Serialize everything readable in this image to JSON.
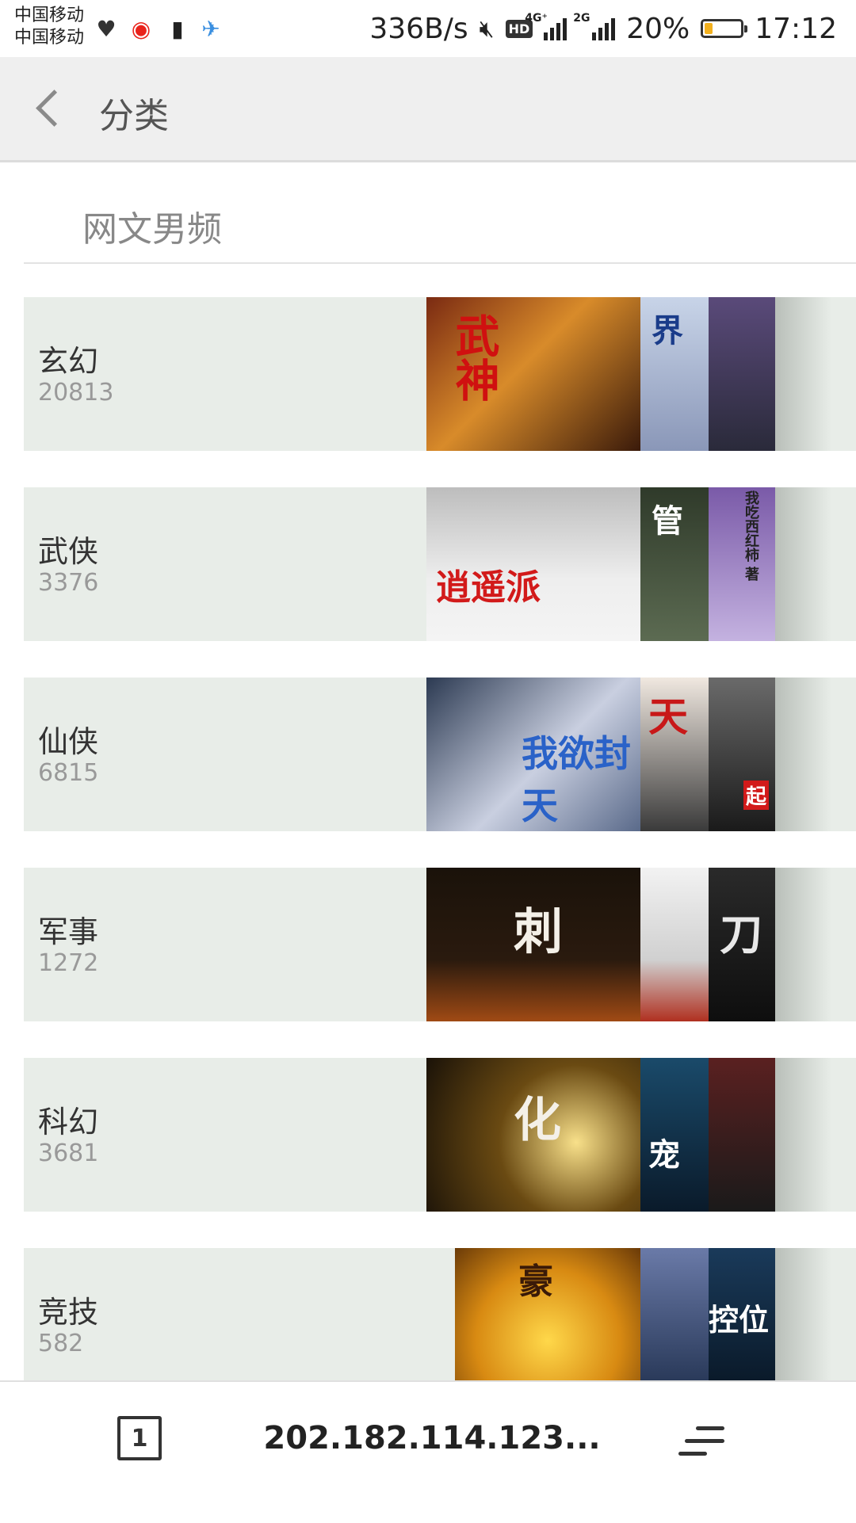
{
  "status_bar": {
    "carrier_1": "中国移动",
    "carrier_2": "中国移动",
    "net_speed": "336B/s",
    "net_1": "4G⁺",
    "net_2": "2G",
    "battery_text": "20%",
    "battery_level": 0.2,
    "time": "17:12",
    "hd": "HD"
  },
  "header": {
    "title": "分类"
  },
  "section": {
    "title": "网文男频"
  },
  "categories": [
    {
      "name": "玄幻",
      "count": "20813",
      "cover_text": [
        "武神",
        "界",
        ""
      ]
    },
    {
      "name": "武侠",
      "count": "3376",
      "cover_text": [
        "逍遥派",
        "管",
        "我吃西红柿 著"
      ]
    },
    {
      "name": "仙侠",
      "count": "6815",
      "cover_text": [
        "我欲封天",
        "天",
        "起"
      ]
    },
    {
      "name": "军事",
      "count": "1272",
      "cover_text": [
        "刺",
        "",
        "刀"
      ]
    },
    {
      "name": "科幻",
      "count": "3681",
      "cover_text": [
        "化",
        "宠",
        ""
      ]
    },
    {
      "name": "竞技",
      "count": "582",
      "cover_text": [
        "豪",
        "",
        "控位"
      ]
    }
  ],
  "bottom_bar": {
    "tabs_count": "1",
    "url": "202.182.114.123..."
  },
  "colors": {
    "card_bg": "#e8ede8",
    "header_bg": "#efefef",
    "battery": "#f2b01e"
  }
}
